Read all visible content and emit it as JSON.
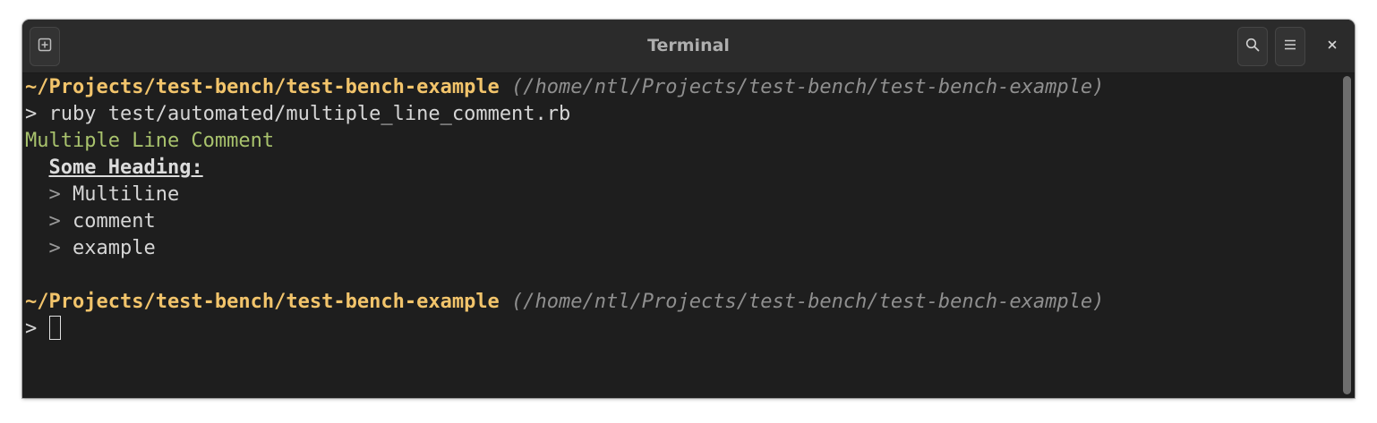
{
  "window": {
    "title": "Terminal"
  },
  "icons": {
    "new_tab": "new-tab-icon",
    "search": "search-icon",
    "menu": "hamburger-menu-icon",
    "close": "close-icon"
  },
  "terminal": {
    "prompt1": {
      "path": "~/Projects/test-bench/test-bench-example",
      "full_path": "(/home/ntl/Projects/test-bench/test-bench-example)",
      "symbol": ">",
      "command": "ruby test/automated/multiple_line_comment.rb"
    },
    "output": {
      "title": "Multiple Line Comment",
      "heading": "Some Heading:",
      "comment_marker": ">",
      "comments": [
        "Multiline",
        "comment",
        "example"
      ]
    },
    "prompt2": {
      "path": "~/Projects/test-bench/test-bench-example",
      "full_path": "(/home/ntl/Projects/test-bench/test-bench-example)",
      "symbol": ">"
    }
  },
  "colors": {
    "path": "#f2c46b",
    "output_title": "#a9c36d",
    "background": "#1e1e1e",
    "titlebar": "#2b2b2b"
  }
}
